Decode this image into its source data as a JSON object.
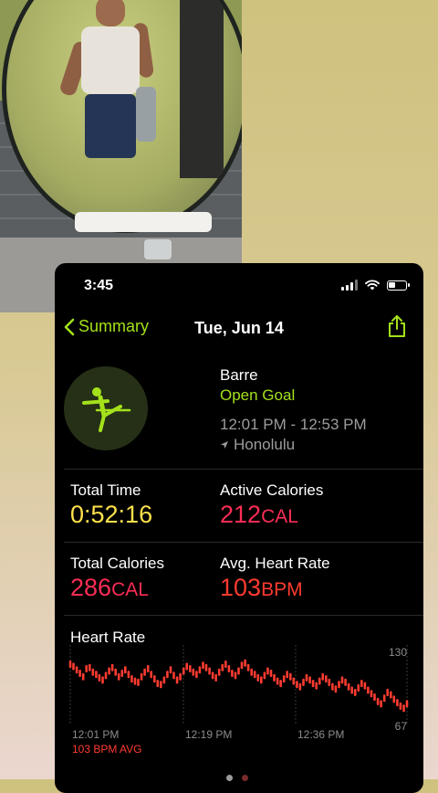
{
  "status_bar": {
    "time": "3:45"
  },
  "nav": {
    "back_label": "Summary",
    "title": "Tue, Jun 14"
  },
  "workout": {
    "name": "Barre",
    "goal": "Open Goal",
    "time_range": "12:01 PM - 12:53 PM",
    "location": "Honolulu",
    "icon": "barre-figure-icon"
  },
  "metrics": {
    "total_time": {
      "label": "Total Time",
      "value": "0:52:16"
    },
    "active_calories": {
      "label": "Active Calories",
      "value": "212",
      "unit": "CAL"
    },
    "total_calories": {
      "label": "Total Calories",
      "value": "286",
      "unit": "CAL"
    },
    "avg_heart_rate": {
      "label": "Avg. Heart Rate",
      "value": "103",
      "unit": "BPM"
    }
  },
  "heart_rate": {
    "title": "Heart Rate",
    "avg_label": "103 BPM AVG"
  },
  "colors": {
    "accent_green": "#a4e11b",
    "time_yellow": "#ffe14c",
    "calories_pink": "#fa2d55",
    "heart_red": "#ff3b30"
  },
  "chart_data": {
    "type": "scatter",
    "title": "Heart Rate",
    "x_tick_labels": [
      "12:01 PM",
      "12:19 PM",
      "12:36 PM"
    ],
    "ylim": [
      67,
      130
    ],
    "y_tick_labels": [
      "130",
      "67"
    ],
    "values": [
      113,
      111,
      108,
      105,
      102,
      109,
      110,
      106,
      104,
      101,
      99,
      103,
      107,
      110,
      106,
      102,
      105,
      108,
      104,
      100,
      98,
      97,
      102,
      106,
      109,
      104,
      100,
      96,
      95,
      99,
      104,
      108,
      103,
      99,
      102,
      107,
      111,
      109,
      106,
      104,
      108,
      112,
      110,
      107,
      103,
      101,
      106,
      110,
      113,
      109,
      105,
      103,
      107,
      112,
      114,
      110,
      106,
      104,
      101,
      99,
      103,
      107,
      105,
      101,
      98,
      96,
      100,
      104,
      102,
      98,
      95,
      93,
      97,
      101,
      99,
      96,
      94,
      98,
      102,
      100,
      97,
      93,
      91,
      95,
      99,
      97,
      93,
      90,
      88,
      92,
      96,
      94,
      90,
      87,
      84,
      80,
      78,
      83,
      88,
      86,
      82,
      79,
      76,
      74,
      78
    ]
  }
}
